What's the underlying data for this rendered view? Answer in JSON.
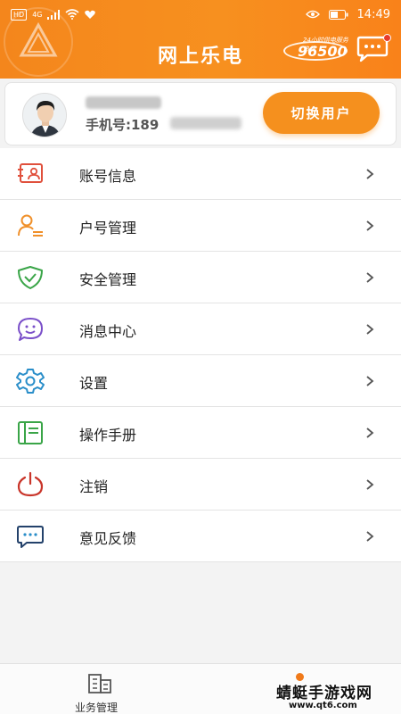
{
  "status_bar": {
    "network_badge": "HD",
    "signal_label": "4G",
    "time": "14:49"
  },
  "header": {
    "title": "网上乐电",
    "hotline_caption": "24小时供电服务热线",
    "hotline_number": "96500",
    "chat_icon": "chat-bubble-icon"
  },
  "user": {
    "phone_prefix": "手机号:189",
    "switch_label": "切换用户"
  },
  "menu": {
    "items": [
      {
        "label": "账号信息",
        "icon": "id-card-icon",
        "color": "#e0503c"
      },
      {
        "label": "户号管理",
        "icon": "user-list-icon",
        "color": "#f0902a"
      },
      {
        "label": "安全管理",
        "icon": "shield-check-icon",
        "color": "#3aa548"
      },
      {
        "label": "消息中心",
        "icon": "smile-bubble-icon",
        "color": "#7a4fc9"
      },
      {
        "label": "设置",
        "icon": "gear-icon",
        "color": "#2a8ec9"
      },
      {
        "label": "操作手册",
        "icon": "manual-book-icon",
        "color": "#3aa548"
      },
      {
        "label": "注销",
        "icon": "power-icon",
        "color": "#c9352a"
      },
      {
        "label": "意见反馈",
        "icon": "feedback-bubble-icon",
        "color": "#24426b"
      }
    ]
  },
  "tabbar": {
    "business_label": "业务管理"
  },
  "watermark": {
    "title": "蜻蜓手游戏网",
    "url": "www.qt6.com"
  },
  "colors": {
    "accent": "#f5901e",
    "header_gradient_start": "#f4861c",
    "badge_red": "#e83a2a"
  }
}
